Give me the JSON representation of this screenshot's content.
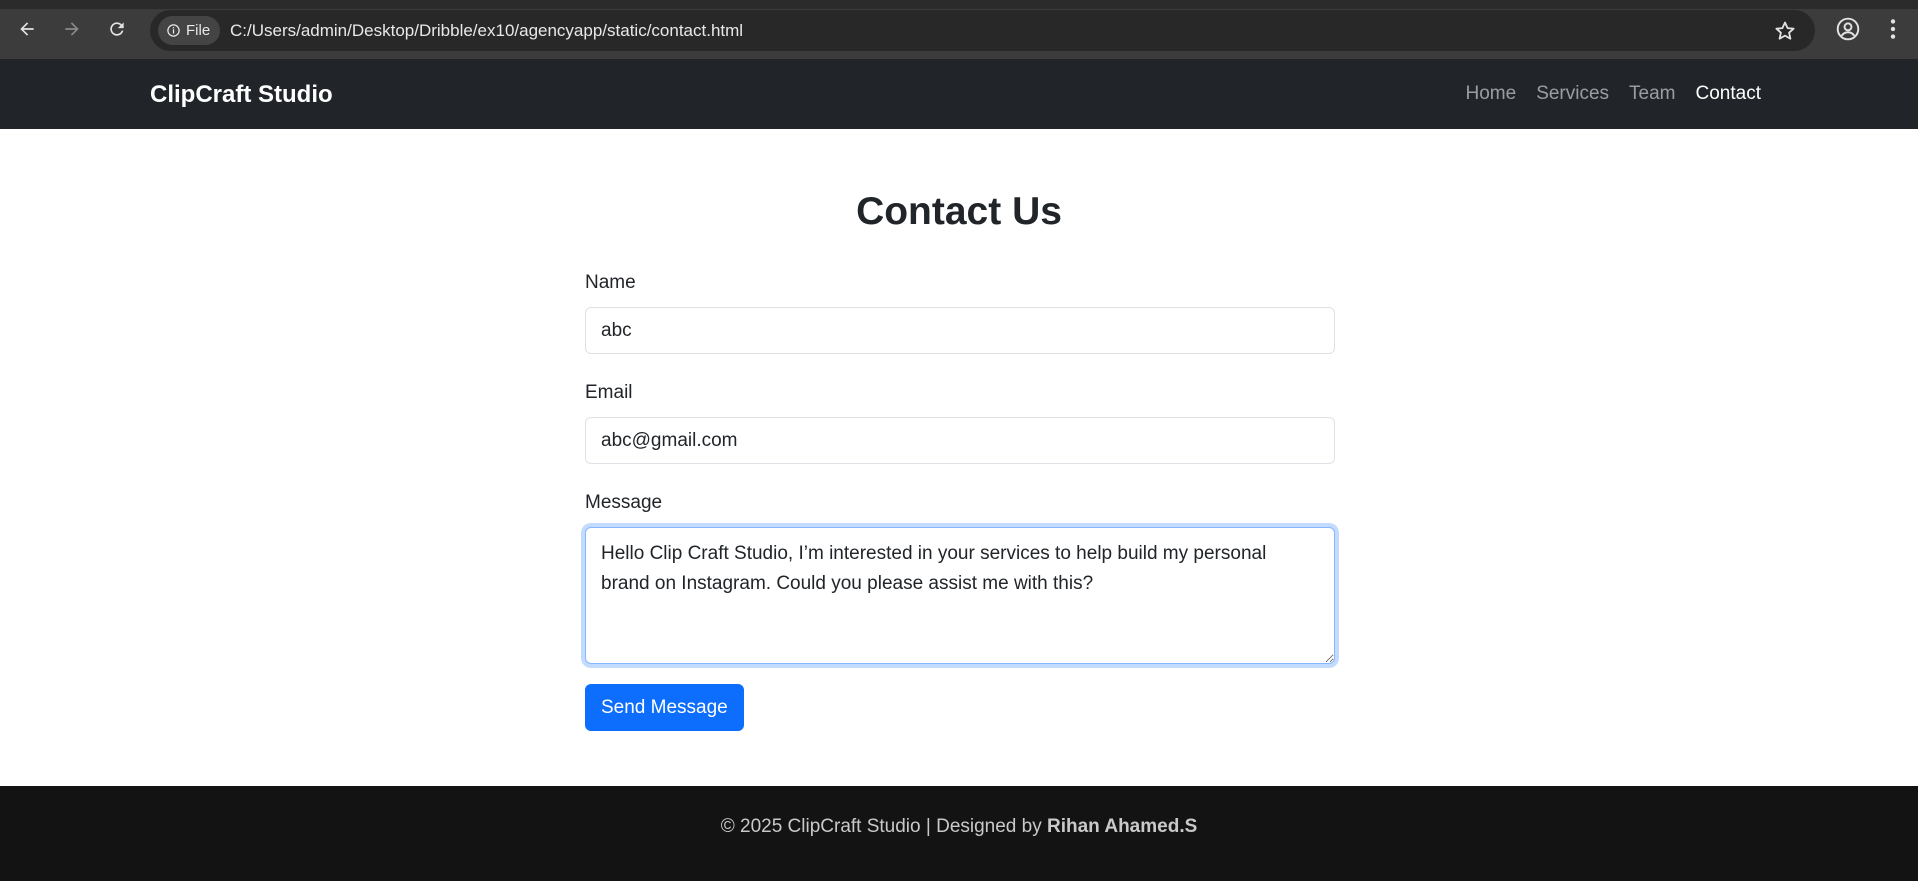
{
  "browser": {
    "site_chip_label": "File",
    "url": "C:/Users/admin/Desktop/Dribble/ex10/agencyapp/static/contact.html"
  },
  "navbar": {
    "brand": "ClipCraft Studio",
    "links": [
      {
        "label": "Home"
      },
      {
        "label": "Services"
      },
      {
        "label": "Team"
      },
      {
        "label": "Contact"
      }
    ]
  },
  "page": {
    "title": "Contact Us"
  },
  "form": {
    "name_label": "Name",
    "name_value": "abc",
    "email_label": "Email",
    "email_value": "abc@gmail.com",
    "message_label": "Message",
    "message_value": "Hello Clip Craft Studio, I’m interested in your services to help build my personal brand on Instagram. Could you please assist me with this?",
    "submit_label": "Send Message"
  },
  "footer": {
    "text_prefix": "© 2025 ClipCraft Studio | Designed by ",
    "designer": "Rihan Ahamed.S"
  },
  "colors": {
    "navbar_bg": "#212529",
    "footer_bg": "#131313",
    "primary": "#0d6efd"
  }
}
